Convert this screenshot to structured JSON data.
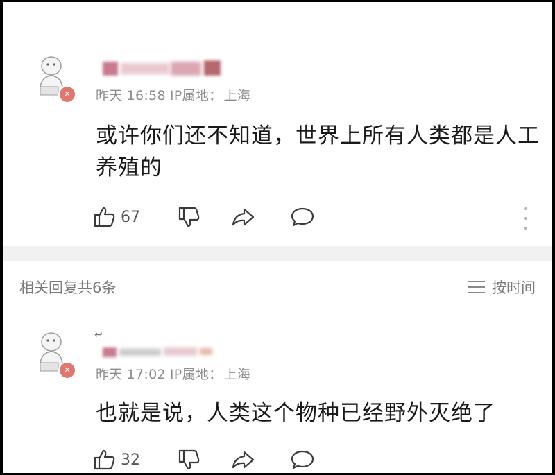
{
  "comments": [
    {
      "meta": {
        "day": "昨天",
        "time": "16:58",
        "ip_label": "IP属地：",
        "location": "上海"
      },
      "content": "或许你们还不知道，世界上所有人类都是人工养殖的",
      "likes": "67",
      "avatar_badge": "✕"
    },
    {
      "meta": {
        "day": "昨天",
        "time": "17:02",
        "ip_label": "IP属地：",
        "location": "上海"
      },
      "content": "也就是说，人类这个物种已经野外灭绝了",
      "likes": "32",
      "reply_mark": "↩",
      "avatar_badge": "✕"
    }
  ],
  "replies_bar": {
    "count_text": "相关回复共6条",
    "sort_label": "按时间"
  },
  "icons": {
    "like": "thumbs-up-icon",
    "dislike": "thumbs-down-icon",
    "share": "share-icon",
    "reply": "comment-bubble-icon",
    "more": "more-vertical-icon",
    "sort": "sort-lines-icon"
  },
  "colors": {
    "text": "#1a1a1a",
    "meta": "#8d8d8d",
    "badge": "#e1766f",
    "redacted": "#c87b8e"
  }
}
